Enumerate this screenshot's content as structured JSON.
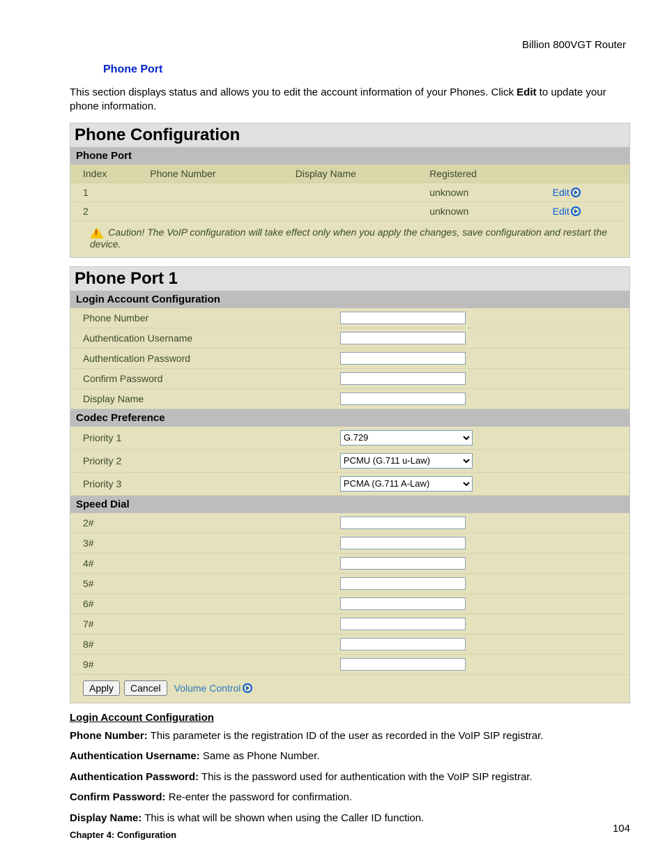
{
  "header": {
    "product": "Billion 800VGT Router"
  },
  "section": {
    "title": "Phone Port"
  },
  "intro": {
    "pre": "This section displays status and allows you to edit the account information of your Phones.    Click ",
    "bold": "Edit",
    "post": " to update your phone information."
  },
  "config_table": {
    "title": "Phone Configuration",
    "subtitle": "Phone Port",
    "headers": {
      "index": "Index",
      "phone": "Phone Number",
      "display": "Display Name",
      "reg": "Registered"
    },
    "rows": [
      {
        "index": "1",
        "phone": "",
        "display": "",
        "reg": "unknown",
        "edit": "Edit"
      },
      {
        "index": "2",
        "phone": "",
        "display": "",
        "reg": "unknown",
        "edit": "Edit"
      }
    ],
    "caution": "Caution! The VoIP configuration will take effect only when you apply the changes, save configuration and restart the device."
  },
  "port1": {
    "title": "Phone Port 1",
    "login_heading": "Login Account Configuration",
    "fields": {
      "phone": "Phone Number",
      "auth_user": "Authentication Username",
      "auth_pass": "Authentication Password",
      "confirm": "Confirm Password",
      "display": "Display Name"
    },
    "codec_heading": "Codec Preference",
    "codec": {
      "p1_label": "Priority 1",
      "p1_value": "G.729",
      "p2_label": "Priority 2",
      "p2_value": "PCMU (G.711 u-Law)",
      "p3_label": "Priority 3",
      "p3_value": "PCMA (G.711 A-Law)"
    },
    "speed_heading": "Speed Dial",
    "speed": [
      "2#",
      "3#",
      "4#",
      "5#",
      "6#",
      "7#",
      "8#",
      "9#"
    ],
    "buttons": {
      "apply": "Apply",
      "cancel": "Cancel",
      "volume": "Volume Control"
    }
  },
  "desc": {
    "heading": "Login Account Configuration",
    "items": [
      {
        "k": "Phone Number:",
        "v": " This parameter is the registration ID of the user as recorded in the VoIP SIP registrar."
      },
      {
        "k": "Authentication Username:",
        "v": " Same as Phone Number."
      },
      {
        "k": "Authentication Password:",
        "v": " This is the password used for authentication with the VoIP SIP registrar."
      },
      {
        "k": "Confirm Password:",
        "v": " Re-enter the password for confirmation."
      },
      {
        "k": "Display Name:",
        "v": " This is what will be shown when using the Caller ID function."
      }
    ]
  },
  "footer": {
    "chapter": "Chapter 4: Configuration",
    "page": "104"
  }
}
